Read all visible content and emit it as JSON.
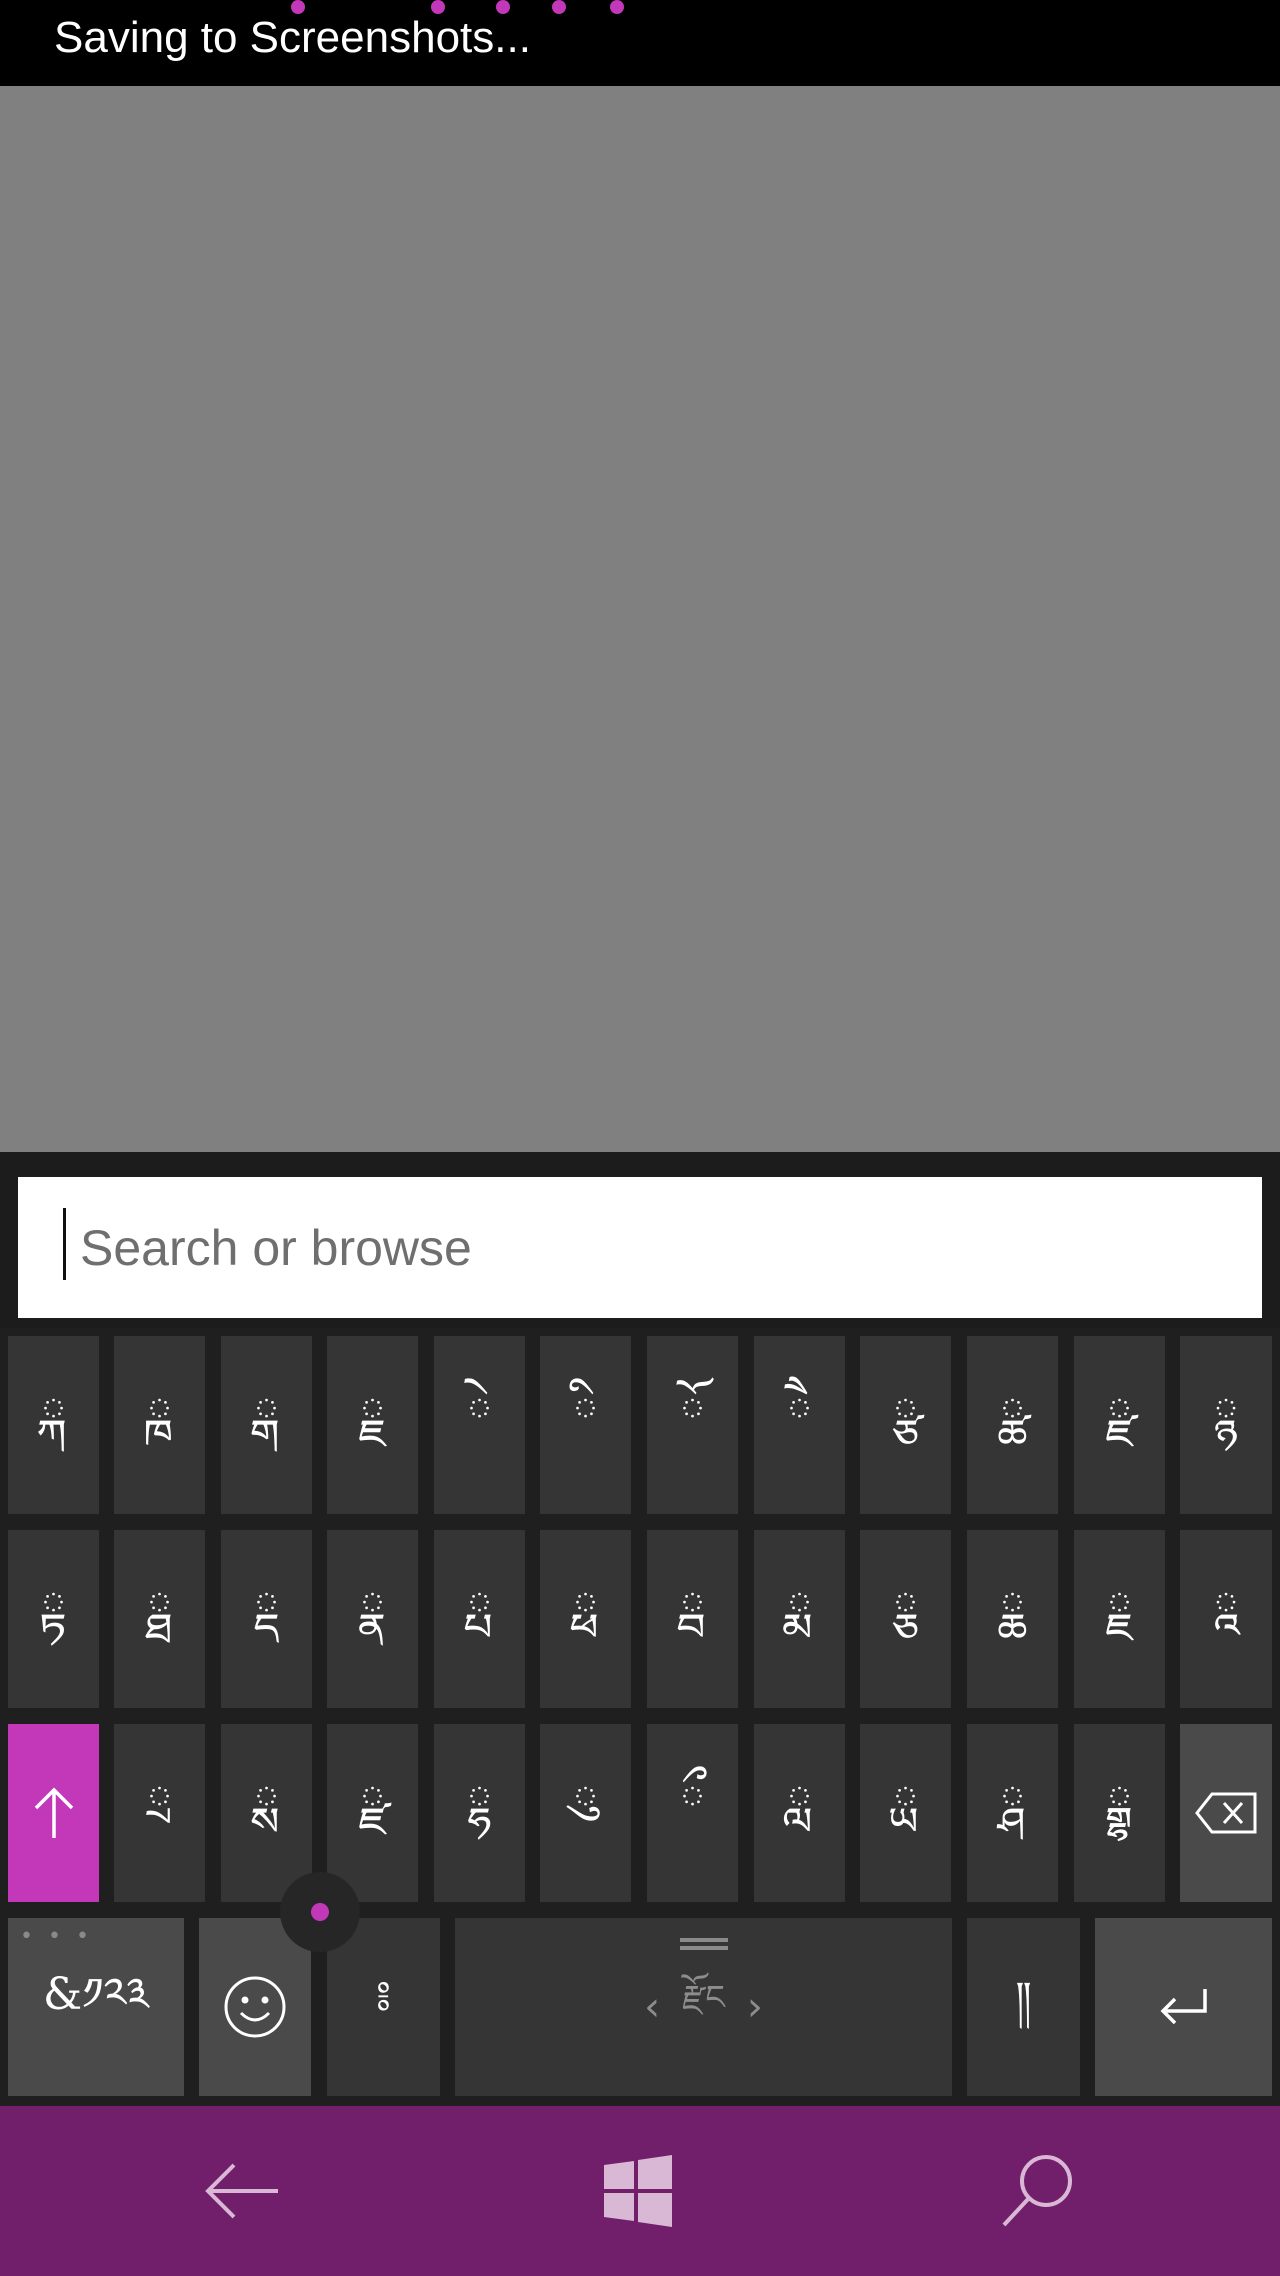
{
  "status_bar": {
    "text": "Saving to Screenshots..."
  },
  "search": {
    "placeholder": "Search or browse",
    "value": ""
  },
  "keyboard": {
    "row1": [
      "ྐ",
      "ྑ",
      "ྒ",
      "ྗ",
      "ེ",
      "ི",
      "ོ",
      "ཻ",
      "ྩ",
      "ྪ",
      "ྫ",
      "ྙ"
    ],
    "row2": [
      "ྟ",
      "ྠ",
      "ྡ",
      "ྣ",
      "ྤ",
      "ྥ",
      "ྦ",
      "ྨ",
      "ྕ",
      "ྖ",
      "ྗ",
      "ྰ"
    ],
    "row3": [
      "ྲ",
      "ྶ",
      "ྫ",
      "ྷ",
      "ུ",
      "ྀ",
      "ླ",
      "ྻ",
      "ྴ",
      "ྒྷ",
      "ྸ"
    ],
    "symbols_label": "&༡༢༣",
    "punct_label": "༔",
    "space_label": "རྫོང",
    "shad_label": "༎",
    "emoji_icon": "smiley-icon",
    "shift_icon": "shift-arrow-icon",
    "backspace_icon": "backspace-icon",
    "enter_icon": "enter-icon"
  },
  "navbar": {
    "back_icon": "back-arrow-icon",
    "home_icon": "windows-logo-icon",
    "search_icon": "search-icon"
  },
  "colors": {
    "accent": "#c238b8",
    "navbar": "#721f6b",
    "status_bar": "#000000",
    "content": "#808080",
    "key": "#353535",
    "func_key": "#4a4a4a"
  }
}
